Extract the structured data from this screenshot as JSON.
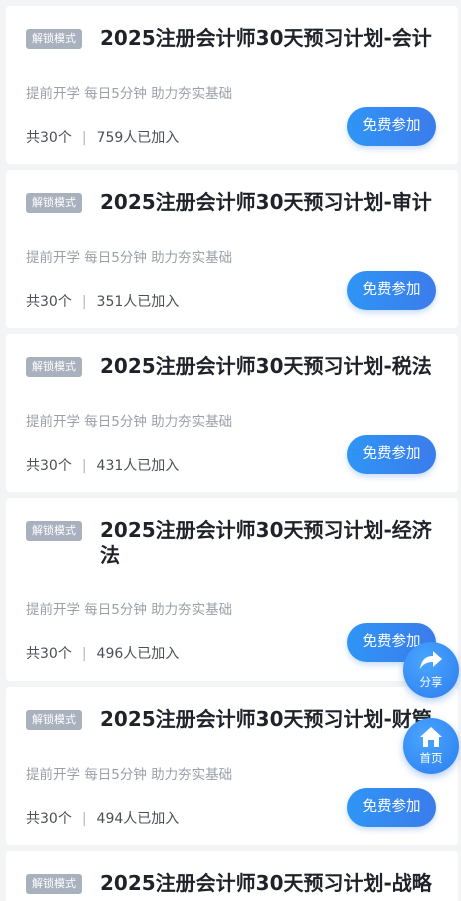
{
  "plans": [
    {
      "tag": "解锁模式",
      "title": "2025注册会计师30天预习计划-会计",
      "desc": "提前开学 每日5分钟 助力夯实基础",
      "count": "共30个",
      "joined": "759人已加入",
      "button": "免费参加"
    },
    {
      "tag": "解锁模式",
      "title": "2025注册会计师30天预习计划-审计",
      "desc": "提前开学 每日5分钟 助力夯实基础",
      "count": "共30个",
      "joined": "351人已加入",
      "button": "免费参加"
    },
    {
      "tag": "解锁模式",
      "title": "2025注册会计师30天预习计划-税法",
      "desc": "提前开学 每日5分钟 助力夯实基础",
      "count": "共30个",
      "joined": "431人已加入",
      "button": "免费参加"
    },
    {
      "tag": "解锁模式",
      "title": "2025注册会计师30天预习计划-经济法",
      "desc": "提前开学 每日5分钟 助力夯实基础",
      "count": "共30个",
      "joined": "496人已加入",
      "button": "免费参加"
    },
    {
      "tag": "解锁模式",
      "title": "2025注册会计师30天预习计划-财管",
      "desc": "提前开学 每日5分钟 助力夯实基础",
      "count": "共30个",
      "joined": "494人已加入",
      "button": "免费参加"
    },
    {
      "tag": "解锁模式",
      "title": "2025注册会计师30天预习计划-战略"
    }
  ],
  "separator": "|",
  "share": {
    "label": "分享",
    "icon": "share-arrow-icon"
  },
  "home": {
    "label": "首页",
    "icon": "home-icon"
  },
  "colors": {
    "accent": "#3389f0",
    "tag_bg": "#a9b1be",
    "page_bg": "#f3f4f6"
  }
}
